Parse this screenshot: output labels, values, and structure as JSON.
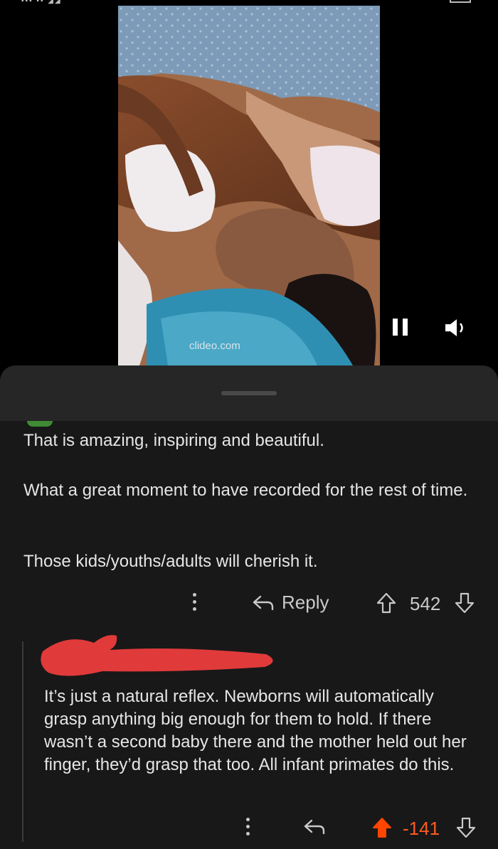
{
  "status_bar": {
    "icons": "▪▪▪ ▪▪ ◢◢"
  },
  "video": {
    "watermark": "clideo.com",
    "controls": {
      "pause_icon": "pause-icon",
      "volume_icon": "volume-icon"
    }
  },
  "comments": [
    {
      "paragraphs": [
        "That is amazing, inspiring and beautiful.",
        "What a great moment to have recorded for the rest of time.",
        "Those kids/youths/adults will cherish it."
      ],
      "reply_label": "Reply",
      "score": "542"
    },
    {
      "author_redacted": true,
      "text": "It’s just a natural reflex. Newborns will automatically grasp anything big enough for them to hold. If there wasn’t a second baby there and the mother held out her finger, they’d grasp that too. All infant primates do this.",
      "score": "-141",
      "upvote_color": "#ff4500"
    }
  ],
  "colors": {
    "sheet": "#181818",
    "downvoted": "#ff5a1f",
    "redaction": "#e03a3a"
  }
}
